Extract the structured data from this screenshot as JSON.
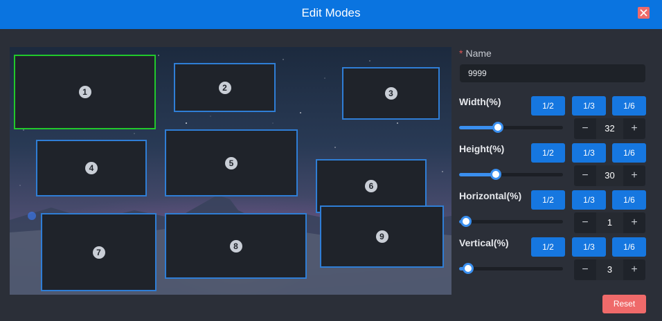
{
  "dialog": {
    "title": "Edit Modes",
    "close_icon": "close-icon"
  },
  "preview": {
    "windows": [
      {
        "label": "1",
        "active": true
      },
      {
        "label": "2",
        "active": false
      },
      {
        "label": "3",
        "active": false
      },
      {
        "label": "4",
        "active": false
      },
      {
        "label": "5",
        "active": false
      },
      {
        "label": "6",
        "active": false
      },
      {
        "label": "7",
        "active": false
      },
      {
        "label": "8",
        "active": false
      },
      {
        "label": "9",
        "active": false
      }
    ]
  },
  "form": {
    "name": {
      "required_mark": "*",
      "label": "Name",
      "value": "9999"
    },
    "fraction_labels": [
      "1/2",
      "1/3",
      "1/6"
    ],
    "width": {
      "label": "Width(%)",
      "value": "32",
      "slider_fraction": 0.32
    },
    "height": {
      "label": "Height(%)",
      "value": "30",
      "slider_fraction": 0.3
    },
    "horizontal": {
      "label": "Horizontal(%)",
      "value": "1",
      "slider_fraction": 0.01
    },
    "vertical": {
      "label": "Vertical(%)",
      "value": "3",
      "slider_fraction": 0.03
    },
    "stepper_minus": "−",
    "stepper_plus": "+",
    "reset_label": "Reset"
  },
  "colors": {
    "header": "#0a74e0",
    "background": "#2b2f38",
    "accent": "#1677e0",
    "active_window_border": "#21c92b",
    "window_border": "#2f7ed6",
    "reset": "#ef6a6a"
  }
}
